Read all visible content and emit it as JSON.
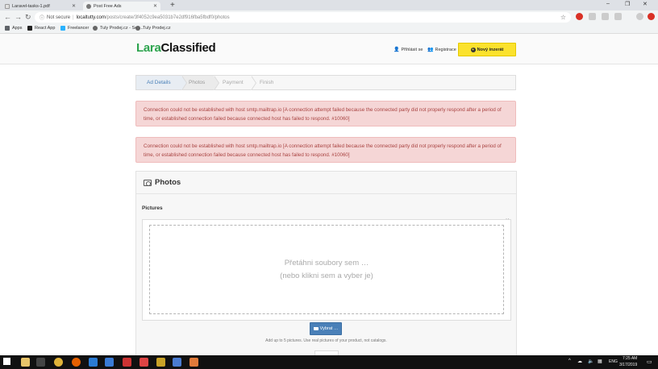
{
  "browser": {
    "tabs": [
      {
        "title": "Laravel-tasks-1.pdf",
        "active": false
      },
      {
        "title": "Post Free Ads",
        "active": true
      }
    ],
    "new_tab": "+",
    "window_controls": {
      "minimize": "–",
      "restore": "❐",
      "close": "✕"
    },
    "nav": {
      "back": "←",
      "forward": "→",
      "reload": "↻"
    },
    "address": {
      "security": "Not secure",
      "host": "localtutty.com",
      "path": "/posts/create/3f4052c9ea5031b7e2df916fba5fbdf0/photos"
    },
    "bookmarks": [
      {
        "label": "Apps",
        "color": "#5f6368"
      },
      {
        "label": "React App",
        "color": "#222222"
      },
      {
        "label": "Freelancer",
        "color": "#29b2fe"
      },
      {
        "label": "Tuly Prodej.cz - Sez...",
        "color": "#666666"
      },
      {
        "label": "Tuly Prodej.cz",
        "color": "#666666"
      }
    ]
  },
  "header": {
    "logo_part1": "Lara",
    "logo_part2": "Classified",
    "login_label": "Přihlásit se",
    "register_label": "Registrace",
    "post_button_label": "Nový inzerát",
    "post_button_icon": "+",
    "brand_green": "#2da44e",
    "button_yellow": "#fbe22d"
  },
  "steps": [
    "Ad Details",
    "Photos",
    "Payment",
    "Finish"
  ],
  "alerts": [
    "Connection could not be established with host smtp.mailtrap.io [A connection attempt failed because the connected party did not properly respond after a period of time, or established connection failed because connected host has failed to respond. #10060]",
    "Connection could not be established with host smtp.mailtrap.io [A connection attempt failed because the connected party did not properly respond after a period of time, or established connection failed because connected host has failed to respond. #10060]"
  ],
  "photos": {
    "title": "Photos",
    "pictures_label": "Pictures",
    "close_label": "×",
    "dropzone_line1": "Přetáhni soubory sem …",
    "dropzone_line2": "(nebo klikni sem a vyber je)",
    "browse_button": "Vybrat …",
    "hint": "Add up to 5 pictures. Use real pictures of your product, not catalogs."
  },
  "taskbar": {
    "language": "ENG",
    "time": "7:25 AM",
    "date": "3/17/2019"
  }
}
